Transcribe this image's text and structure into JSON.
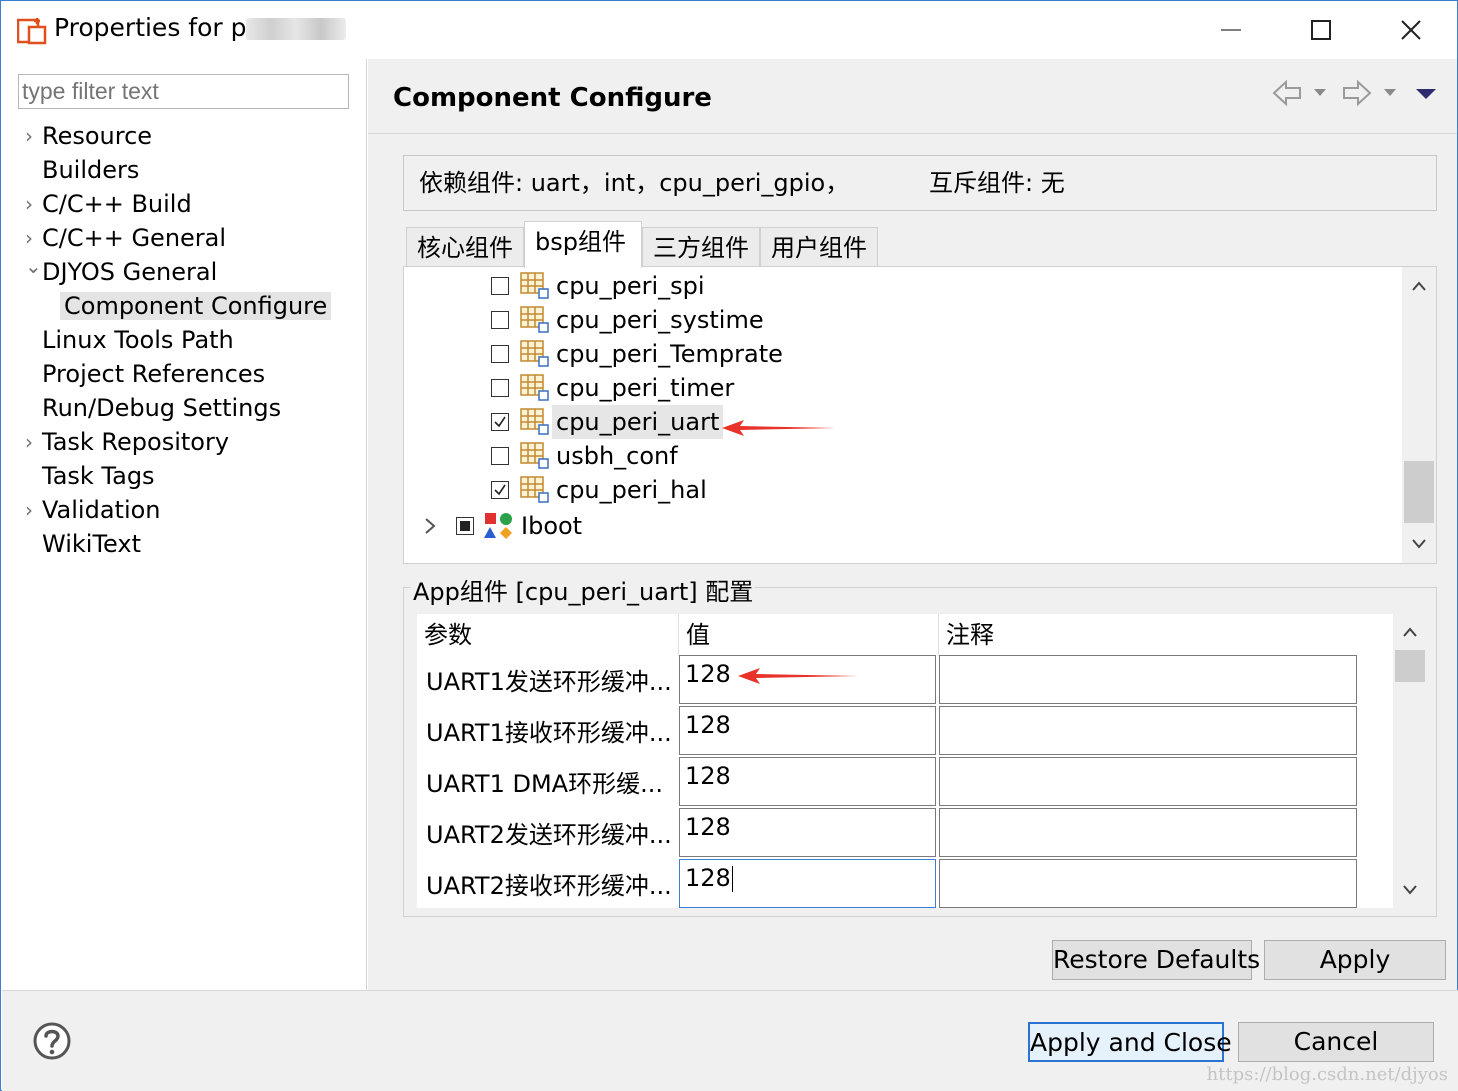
{
  "window": {
    "title_prefix": "Properties for p",
    "controls": [
      "minimize",
      "maximize",
      "close"
    ]
  },
  "filter": {
    "placeholder": "type filter text"
  },
  "nav": {
    "items": [
      {
        "label": "Resource",
        "expandable": true
      },
      {
        "label": "Builders",
        "expandable": false
      },
      {
        "label": "C/C++ Build",
        "expandable": true
      },
      {
        "label": "C/C++ General",
        "expandable": true
      },
      {
        "label": "DJYOS General",
        "expandable": true,
        "expanded": true
      },
      {
        "label": "Component Configure",
        "child": true,
        "selected": true
      },
      {
        "label": "Linux Tools Path",
        "expandable": false
      },
      {
        "label": "Project References",
        "expandable": false
      },
      {
        "label": "Run/Debug Settings",
        "expandable": false
      },
      {
        "label": "Task Repository",
        "expandable": true
      },
      {
        "label": "Task Tags",
        "expandable": false
      },
      {
        "label": "Validation",
        "expandable": true
      },
      {
        "label": "WikiText",
        "expandable": false
      }
    ]
  },
  "page": {
    "title": "Component Configure",
    "dependencies": "依赖组件: uart，int，cpu_peri_gpio，",
    "mutex": "互斥组件: 无"
  },
  "tabs": [
    "核心组件",
    "bsp组件",
    "三方组件",
    "用户组件"
  ],
  "active_tab": "bsp组件",
  "components": [
    {
      "label": "cpu_peri_spi",
      "checked": false
    },
    {
      "label": "cpu_peri_systime",
      "checked": false
    },
    {
      "label": "cpu_peri_Temprate",
      "checked": false
    },
    {
      "label": "cpu_peri_timer",
      "checked": false
    },
    {
      "label": "cpu_peri_uart",
      "checked": true,
      "selected": true
    },
    {
      "label": "usbh_conf",
      "checked": false
    },
    {
      "label": "cpu_peri_hal",
      "checked": true
    }
  ],
  "group_item": {
    "label": "Iboot",
    "state": "partial"
  },
  "config": {
    "title": "App组件 [cpu_peri_uart] 配置",
    "headers": [
      "参数",
      "值",
      "注释"
    ],
    "rows": [
      {
        "param": "UART1发送环形缓冲...",
        "value": "128",
        "note": ""
      },
      {
        "param": "UART1接收环形缓冲...",
        "value": "128",
        "note": ""
      },
      {
        "param": "UART1 DMA环形缓...",
        "value": "128",
        "note": ""
      },
      {
        "param": "UART2发送环形缓冲...",
        "value": "128",
        "note": ""
      },
      {
        "param": "UART2接收环形缓冲...",
        "value": "128",
        "note": ""
      }
    ]
  },
  "buttons": {
    "restore_defaults": "Restore Defaults",
    "apply": "Apply",
    "apply_close": "Apply and Close",
    "cancel": "Cancel"
  },
  "watermark": "https://blog.csdn.net/djyos",
  "colors": {
    "accent": "#2a73d1",
    "annotation_arrow": "#e8332b",
    "app_icon": "#e0501e"
  }
}
